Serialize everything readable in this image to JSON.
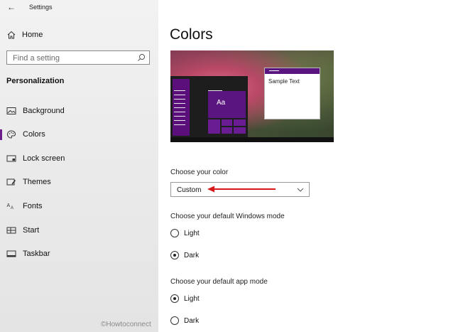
{
  "titlebar": {
    "back_icon": "back-arrow-icon",
    "title": "Settings"
  },
  "sidebar": {
    "home_label": "Home",
    "search_placeholder": "Find a setting",
    "section_title": "Personalization",
    "items": [
      {
        "label": "Background",
        "icon": "image-icon"
      },
      {
        "label": "Colors",
        "icon": "palette-icon",
        "active": true
      },
      {
        "label": "Lock screen",
        "icon": "lock-screen-icon"
      },
      {
        "label": "Themes",
        "icon": "themes-icon"
      },
      {
        "label": "Fonts",
        "icon": "fonts-icon"
      },
      {
        "label": "Start",
        "icon": "start-icon"
      },
      {
        "label": "Taskbar",
        "icon": "taskbar-icon"
      }
    ],
    "watermark": "©Howtoconnect"
  },
  "main": {
    "title": "Colors",
    "preview": {
      "tile_text": "Aa",
      "window_text": "Sample Text",
      "accent": "#5b1581"
    },
    "choose_color": {
      "label": "Choose your color",
      "selected": "Custom"
    },
    "windows_mode": {
      "label": "Choose your default Windows mode",
      "options": [
        "Light",
        "Dark"
      ],
      "selected": "Dark"
    },
    "app_mode": {
      "label": "Choose your default app mode",
      "options": [
        "Light",
        "Dark"
      ],
      "selected": "Light"
    }
  },
  "colors": {
    "accent": "#6b1e8c",
    "annotation_arrow": "#d7191c"
  }
}
